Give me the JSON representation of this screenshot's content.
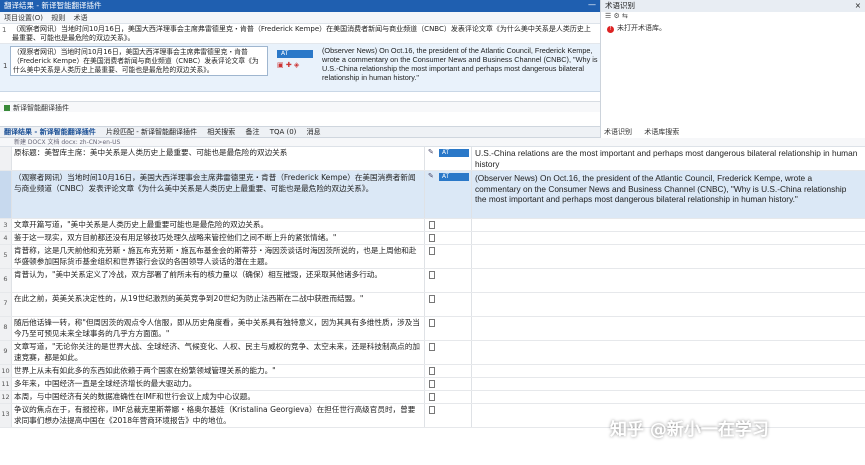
{
  "window": {
    "title": "翻译结果 - 新译智能翻译插件",
    "min_glyph": "—"
  },
  "toolbar": {
    "items": [
      "项目设置(O)",
      "规则",
      "术语"
    ]
  },
  "source_block": {
    "num": "1",
    "text": "（观察者网讯）当地时间10月16日，美国大西洋理事会主席弗雷德里克・肯普（Frederick Kempe）在美国消费者新闻与商业频道（CNBC）发表评论文章《为什么美中关系是人类历史上最重要、可能也是最危险的双边关系》。"
  },
  "match": {
    "num": "1",
    "source": "（观察者网讯）当地时间10月16日，美国大西洋理事会主席弗雷德里克・肯普（Frederick Kempe）在美国消费者新闻与商业频道（CNBC）发表评论文章《为什么美中关系是人类历史上最重要、可能也是最危险的双边关系》。",
    "badge": "AT",
    "target": "(Observer News) On Oct.16, the president of the Atlantic Council, Frederick Kempe, wrote a commentary on the Consumer News and Business Channel (CNBC), \"Why is U.S.-China relationship the most important and perhaps most dangerous bilateral relationship in human history.\""
  },
  "panel_label": "新译智能翻译插件",
  "right_panel": {
    "title": "术语识别",
    "close": "×",
    "tools": "☰ ⚙ ⇆",
    "warning": "未打开术语库。"
  },
  "tabs": [
    "翻译结果 - 新译智能翻译插件",
    "片段匹配 - 新译智能翻译插件",
    "相关搜索",
    "备注",
    "TQA (0)",
    "消息"
  ],
  "tabs_right": [
    "术语识别",
    "术语库搜索"
  ],
  "subbar": "新建 DOCX 文档 docx: zh-CN>en-US",
  "rows": [
    {
      "n": "",
      "src": "原标题：美智库主席：美中关系是人类历史上最重要、可能也是最危险的双边关系",
      "status": "AT",
      "tgt": "U.S.-China relations are the most important and perhaps most dangerous bilateral relationship in human history"
    },
    {
      "n": "",
      "src": "（观察者网讯）当地时间10月16日，美国大西洋理事会主席弗雷德里克・肯普（Frederick Kempe）在美国消费者新闻与商业频道（CNBC）发表评论文章《为什么美中关系是人类历史上最重要、可能也是最危险的双边关系》。",
      "status": "AT",
      "tgt": "(Observer News) On Oct.16, the president of the Atlantic Council, Frederick Kempe, wrote a commentary on the Consumer News and Business Channel (CNBC), \"Why is U.S.-China relationship the most important and perhaps most dangerous bilateral relationship in human history.\""
    },
    {
      "n": "3",
      "src": "文章开篇写道，\"美中关系是人类历史上最重要可能也是最危险的双边关系。",
      "status": "",
      "tgt": ""
    },
    {
      "n": "4",
      "src": "鉴于这一现实，双方目前都还没有用足够技巧处理久战略来管控他们之间不断上升的紧张情绪。\"",
      "status": "",
      "tgt": ""
    },
    {
      "n": "5",
      "src": "肯普称，这是几天前他和克劳斯・施瓦布克劳斯・施瓦布基金会的斯蒂芬・海因茨谈话时海因茨所说的，也是上周他和赴华盛顿参加国际货币基金组织和世界银行会议的各国领导人谈话的潜在主题。",
      "status": "",
      "tgt": ""
    },
    {
      "n": "6",
      "src": "肯普认为，\"美中关系定义了冷战，双方部署了前所未有的核力量以（确保）相互摧毁，还采取其他诸多行动。",
      "status": "",
      "tgt": ""
    },
    {
      "n": "7",
      "src": "在此之前，英美关系决定性的，从19世纪激烈的美英竞争到20世纪为防止法西斯在二战中获胜而结盟。\"",
      "status": "",
      "tgt": ""
    },
    {
      "n": "8",
      "src": "随后他话锋一转，称\"但周因茨的观点令人信服，即从历史角度看，美中关系具有独特意义，因为其具有多维性质，涉及当今乃至可预见未来全球事务的几乎方方面面。\"",
      "status": "",
      "tgt": ""
    },
    {
      "n": "9",
      "src": "文章写道，\"无论你关注的是世界大战、全球经济、气候变化、人权、民主与威权的竞争、太空未来，还是科技制高点的加速竞赛，都是如此。",
      "status": "",
      "tgt": ""
    },
    {
      "n": "10",
      "src": "世界上从未有如此多的东西如此依赖于两个国家在纷繁领域管理关系的能力。\"",
      "status": "",
      "tgt": ""
    },
    {
      "n": "11",
      "src": "多年来，中国经济一直是全球经济增长的最大驱动力。",
      "status": "",
      "tgt": ""
    },
    {
      "n": "12",
      "src": "本周，与中国经济有关的数据准确性在IMF和世行会议上成为中心议题。",
      "status": "",
      "tgt": ""
    },
    {
      "n": "13",
      "src": "争议的焦点在于，有报控称，IMF总裁克里斯蒂娜・格奥尔基娃（Kristalina Georgieva）在担任世行高级官员时，曾要求同事们想办法提高中国在《2018年营商环境报告》中的地位。",
      "status": "",
      "tgt": ""
    }
  ],
  "watermark": "知乎 @新小一在学习"
}
